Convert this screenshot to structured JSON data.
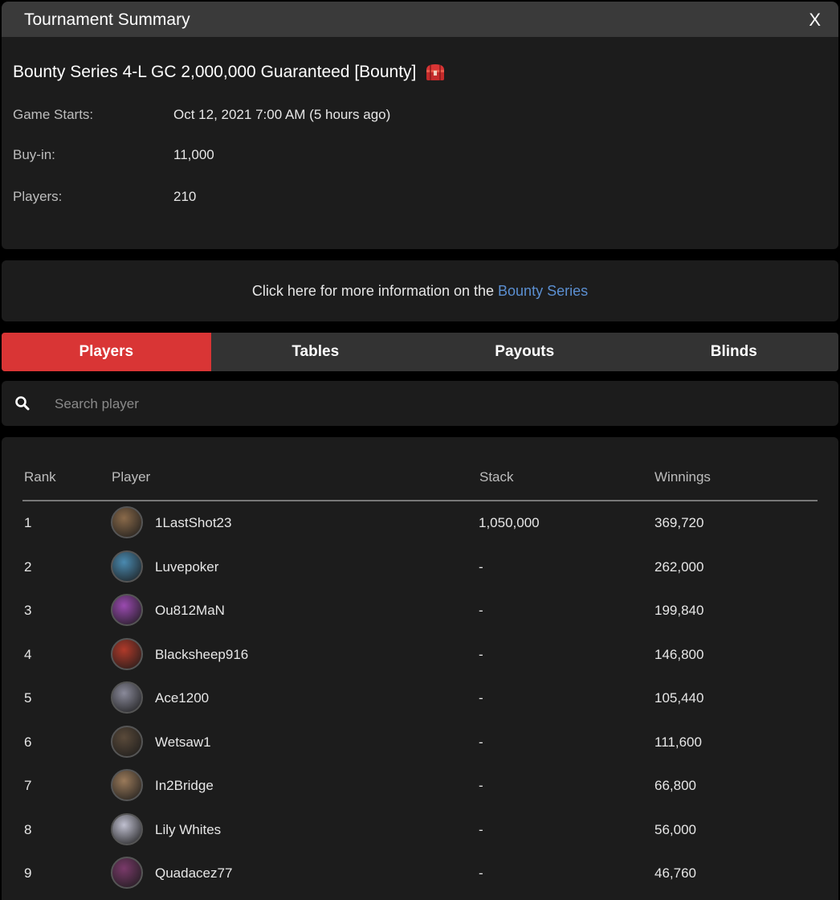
{
  "window": {
    "title": "Tournament Summary",
    "close_label": "X"
  },
  "tournament": {
    "name": "Bounty Series 4-L GC 2,000,000 Guaranteed [Bounty]",
    "game_starts_label": "Game Starts:",
    "game_starts_value": "Oct 12, 2021 7:00 AM (5 hours ago)",
    "buyin_label": "Buy-in:",
    "buyin_value": "11,000",
    "players_label": "Players:",
    "players_value": "210"
  },
  "info_link": {
    "text": "Click here for more information on the",
    "link_text": "Bounty Series"
  },
  "tabs": [
    {
      "label": "Players",
      "active": true
    },
    {
      "label": "Tables",
      "active": false
    },
    {
      "label": "Payouts",
      "active": false
    },
    {
      "label": "Blinds",
      "active": false
    }
  ],
  "search": {
    "placeholder": "Search player"
  },
  "table": {
    "headers": {
      "rank": "Rank",
      "player": "Player",
      "stack": "Stack",
      "winnings": "Winnings"
    },
    "rows": [
      {
        "rank": "1",
        "player": "1LastShot23",
        "stack": "1,050,000",
        "winnings": "369,720",
        "avatar": "#8a6a4a"
      },
      {
        "rank": "2",
        "player": "Luvepoker",
        "stack": "-",
        "winnings": "262,000",
        "avatar": "#4a8ab0"
      },
      {
        "rank": "3",
        "player": "Ou812MaN",
        "stack": "-",
        "winnings": "199,840",
        "avatar": "#9a4ab0"
      },
      {
        "rank": "4",
        "player": "Blacksheep916",
        "stack": "-",
        "winnings": "146,800",
        "avatar": "#b03a2a"
      },
      {
        "rank": "5",
        "player": "Ace1200",
        "stack": "-",
        "winnings": "105,440",
        "avatar": "#8a8a9a"
      },
      {
        "rank": "6",
        "player": "Wetsaw1",
        "stack": "-",
        "winnings": "111,600",
        "avatar": "#5a4a3a"
      },
      {
        "rank": "7",
        "player": "In2Bridge",
        "stack": "-",
        "winnings": "66,800",
        "avatar": "#9a7a5a"
      },
      {
        "rank": "8",
        "player": "Lily Whites",
        "stack": "-",
        "winnings": "56,000",
        "avatar": "#c0c0d0"
      },
      {
        "rank": "9",
        "player": "Quadacez77",
        "stack": "-",
        "winnings": "46,760",
        "avatar": "#7a3a6a"
      }
    ]
  },
  "colors": {
    "accent": "#d93535",
    "link": "#5b8fd1",
    "panel": "#1c1c1c",
    "titlebar": "#3a3a3a"
  }
}
